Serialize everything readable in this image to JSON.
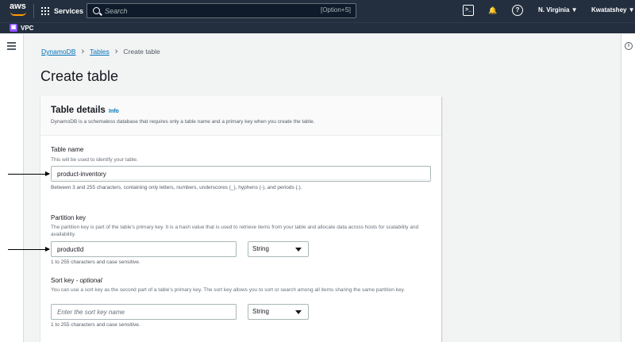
{
  "topnav": {
    "logo_text": "aws",
    "services_label": "Services",
    "search_placeholder": "Search",
    "search_shortcut": "[Option+S]",
    "region_label": "N. Virginia ▼",
    "user_label": "Kwatatshey ▼",
    "cloudshell_icon_glyph": ">_",
    "bell_icon_glyph": "🔔",
    "help_icon_glyph": "?"
  },
  "favorites": {
    "vpc_label": "VPC",
    "vpc_icon_color": "#8c4fff"
  },
  "breadcrumb": {
    "items": [
      "DynamoDB",
      "Tables",
      "Create table"
    ],
    "separator": "›"
  },
  "page": {
    "title": "Create table"
  },
  "panel": {
    "title": "Table details",
    "info_link": "Info",
    "description": "DynamoDB is a schemaless database that requires only a table name and a primary key when you create the table."
  },
  "table_name": {
    "label": "Table name",
    "description": "This will be used to identify your table.",
    "value": "product-inventory",
    "hint": "Between 3 and 255 characters, containing only letters, numbers, underscores (_), hyphens (-), and periods (.)."
  },
  "partition_key": {
    "label": "Partition key",
    "description": "The partition key is part of the table's primary key. It is a hash value that is used to retrieve items from your table and allocate data across hosts for scalability and availability.",
    "value": "productId",
    "type": "String",
    "hint": "1 to 255 characters and case sensitive."
  },
  "sort_key": {
    "label": "Sort key",
    "label_suffix": " - optional",
    "description": "You can use a sort key as the second part of a table's primary key. The sort key allows you to sort or search among all items sharing the same partition key.",
    "placeholder": "Enter the sort key name",
    "type": "String",
    "hint": "1 to 255 characters and case sensitive."
  },
  "colors": {
    "nav_bg": "#232f3e",
    "link": "#0073bb",
    "accent": "#ff9900",
    "page_bg": "#f2f3f3"
  },
  "info_icon_glyph": "i"
}
